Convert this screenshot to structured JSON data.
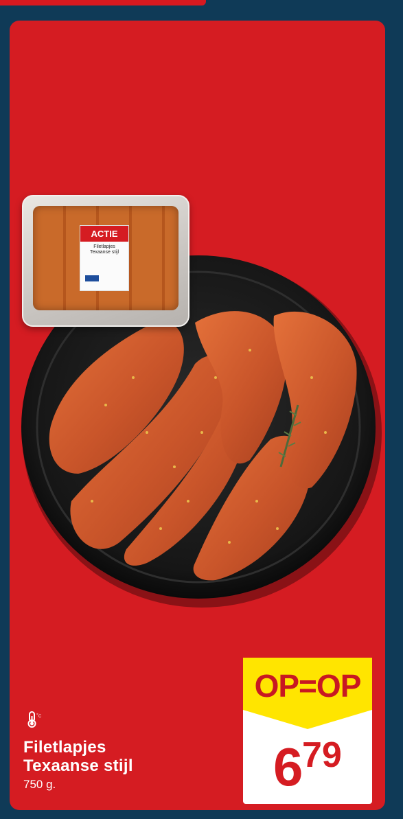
{
  "pack": {
    "badge": "ACTIE",
    "name": "Filetlapjes\nTexaanse stijl"
  },
  "product": {
    "name": "Filetlapjes Texaanse stijl",
    "weight": "750 g.",
    "storage_icon": "thermometer-cold-icon"
  },
  "offer": {
    "label": "OP=OP",
    "price_euros": "6",
    "price_cents": "79"
  },
  "colors": {
    "background": "#d51c22",
    "frame": "#0f3a57",
    "badge_yellow": "#ffe500",
    "price_red": "#d51c22"
  }
}
